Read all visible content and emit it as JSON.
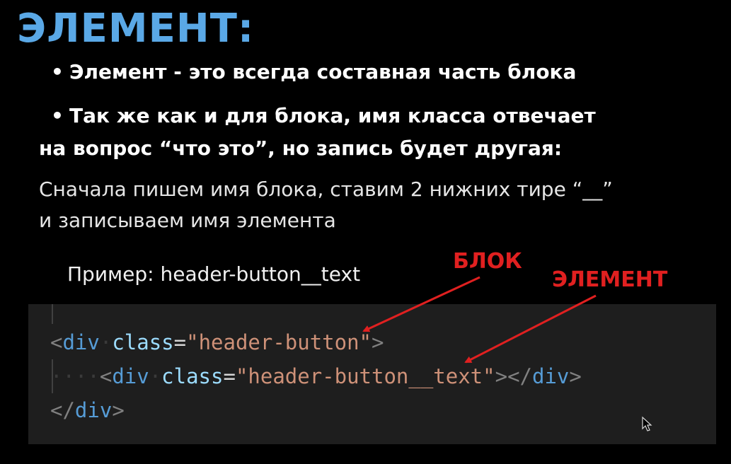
{
  "slide": {
    "title": "ЭЛЕМЕНТ:",
    "bullets": [
      "Элемент - это всегда составная часть блока",
      "Так же как и для блока, имя класса отвечает"
    ],
    "bullet_continuation": "на вопрос “что это”, но запись будет другая:",
    "explanation_lines": [
      "Сначала пишем имя блока, ставим 2 нижних тире “__”",
      "и записываем имя элемента"
    ],
    "example": "Пример: header-button__text",
    "bullet_glyph": "•"
  },
  "annotations": {
    "block_label": "БЛОК",
    "element_label": "ЭЛЕМЕНТ",
    "color": "#e02020"
  },
  "code": {
    "line1": {
      "open": "<",
      "tag": "div",
      "space": "·",
      "attr": "class",
      "eq": "=",
      "value": "\"header-button\"",
      "close": ">"
    },
    "line2": {
      "indent": "····",
      "open": "<",
      "tag": "div",
      "space": "·",
      "attr": "class",
      "eq": "=",
      "value": "\"header-button__text\"",
      "close": "></",
      "close_tag": "div",
      "end": ">"
    },
    "line3": {
      "open": "</",
      "tag": "div",
      "close": ">"
    }
  },
  "colors": {
    "title": "#5aa8e6",
    "background": "#000000",
    "code_background": "#1e1e1e",
    "code_tag": "#569cd6",
    "code_attr": "#9cdcfe",
    "code_string": "#ce9178",
    "code_punct": "#808080"
  },
  "icons": {
    "cursor": "mouse-pointer-icon"
  }
}
